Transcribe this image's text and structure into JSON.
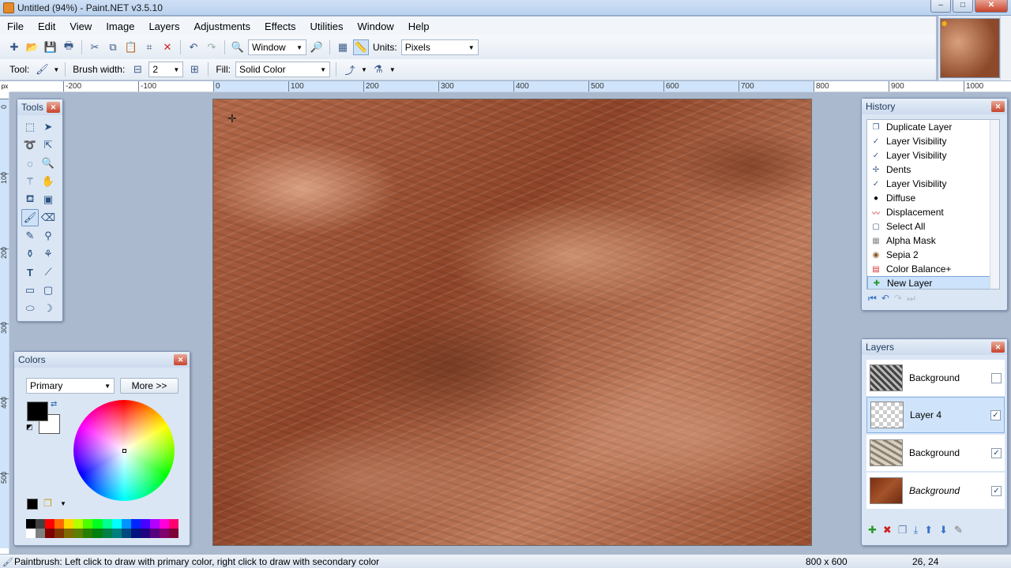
{
  "window": {
    "title": "Untitled (94%) - Paint.NET v3.5.10",
    "controls": [
      "–",
      "□",
      "✕"
    ]
  },
  "menu": [
    "File",
    "Edit",
    "View",
    "Image",
    "Layers",
    "Adjustments",
    "Effects",
    "Utilities",
    "Window",
    "Help"
  ],
  "toolbar": {
    "zoom_value": "Window",
    "units_label": "Units:",
    "units_value": "Pixels",
    "tool_label": "Tool:",
    "brush_width_label": "Brush width:",
    "brush_width_value": "2",
    "fill_label": "Fill:",
    "fill_value": "Solid Color"
  },
  "ruler": {
    "corner": "px",
    "h_ticks": [
      "-200",
      "-100",
      "0",
      "100",
      "200",
      "300",
      "400",
      "500",
      "600",
      "700",
      "800",
      "900",
      "1000"
    ],
    "v_ticks": [
      "0",
      "100",
      "200",
      "300",
      "400",
      "500"
    ]
  },
  "tools_window": {
    "title": "Tools",
    "icons": [
      "rect-select-icon",
      "move-selection-icon",
      "lasso-icon",
      "move-selected-icon",
      "ellipse-select-icon",
      "zoom-icon",
      "magic-wand-icon",
      "pan-icon",
      "paint-bucket-icon",
      "gradient-icon",
      "paintbrush-icon",
      "eraser-icon",
      "pencil-icon",
      "color-picker-icon",
      "clone-stamp-icon",
      "recolor-icon",
      "text-icon",
      "line-curve-icon",
      "rectangle-icon",
      "rounded-rectangle-icon",
      "ellipse-icon",
      "freeform-shape-icon"
    ]
  },
  "history_window": {
    "title": "History",
    "items": [
      "Duplicate Layer",
      "Layer Visibility",
      "Layer Visibility",
      "Dents",
      "Layer Visibility",
      "Diffuse",
      "Displacement",
      "Select All",
      "Alpha Mask",
      "Sepia 2",
      "Color Balance+",
      "New Layer"
    ],
    "current_index": 11
  },
  "layers_window": {
    "title": "Layers",
    "layers": [
      {
        "name": "Background",
        "visible": false
      },
      {
        "name": "Layer 4",
        "visible": true
      },
      {
        "name": "Background",
        "visible": true
      },
      {
        "name": "Background",
        "visible": true
      }
    ],
    "selected_index": 1
  },
  "colors_window": {
    "title": "Colors",
    "mode_value": "Primary",
    "more_label": "More >>",
    "primary_color": "#000000",
    "secondary_color": "#ffffff"
  },
  "palette": [
    "#000000",
    "#404040",
    "#ff0000",
    "#ff6a00",
    "#ffd800",
    "#b6ff00",
    "#4cff00",
    "#00ff21",
    "#00ff90",
    "#00ffff",
    "#0094ff",
    "#0026ff",
    "#4800ff",
    "#b200ff",
    "#ff00dc",
    "#ff006e",
    "#ffffff",
    "#808080",
    "#7f0000",
    "#7f3300",
    "#7f6a00",
    "#5b7f00",
    "#267f00",
    "#007f0e",
    "#007f46",
    "#007f7f",
    "#004a7f",
    "#00137f",
    "#21007f",
    "#57007f",
    "#7f006e",
    "#7f0037"
  ],
  "status": {
    "message": "Paintbrush: Left click to draw with primary color, right click to draw with secondary color",
    "image_size": "800 x 600",
    "cursor_pos": "26, 24"
  }
}
